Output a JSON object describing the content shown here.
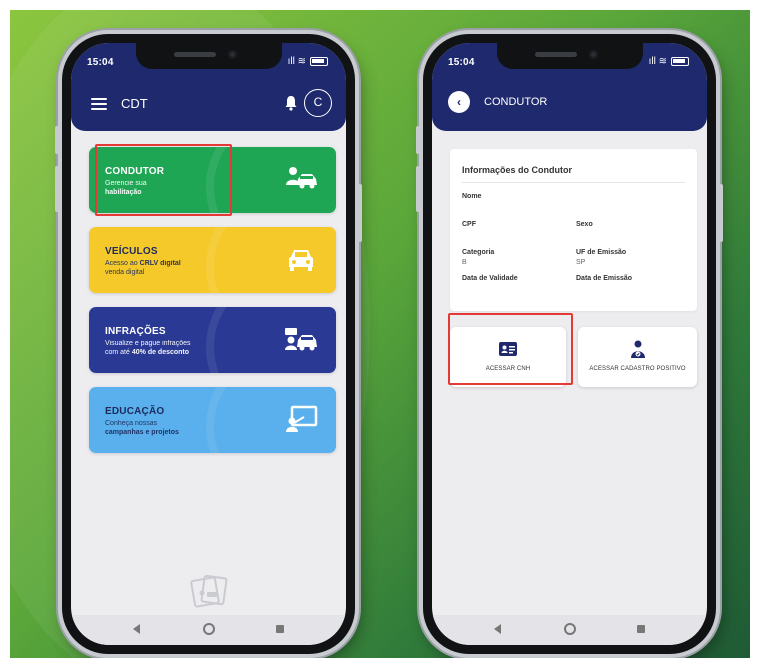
{
  "colors": {
    "appbar": "#1f2a6e",
    "condutor": "#1fa655",
    "veiculos": "#f6c92a",
    "infracoes": "#2a3a94",
    "educacao": "#5ab0ec",
    "highlight": "#e53935"
  },
  "home": {
    "status": {
      "time": "15:04",
      "icons": "ıll ≋"
    },
    "appbar": {
      "menu_icon": "hamburger-menu-icon",
      "title": "CDT",
      "bell_icon": "bell-icon",
      "avatar_letter": "C"
    },
    "cards": [
      {
        "title": "CONDUTOR",
        "desc_1": "Gerencie sua",
        "desc_2": "habilitação",
        "icon": "driver-car-icon"
      },
      {
        "title": "VEÍCULOS",
        "desc_1a": "Acesso ao ",
        "desc_1b": "CRLV digital",
        "desc_2": "venda digital",
        "icon": "car-front-icon"
      },
      {
        "title": "INFRAÇÕES",
        "desc_1": "Visualize e pague infrações",
        "desc_2a": "com até ",
        "desc_2b": "40% de desconto",
        "icon": "traffic-fine-icon"
      },
      {
        "title": "EDUCAÇÃO",
        "desc_1": "Conheça nossas",
        "desc_2": "campanhas e projetos",
        "icon": "presentation-icon"
      }
    ]
  },
  "condutor": {
    "status": {
      "time": "15:04",
      "icons": "ıll ≋"
    },
    "appbar": {
      "back_icon": "back-arrow-icon",
      "title": "CONDUTOR"
    },
    "info": {
      "title": "Informações do Condutor",
      "fields": [
        {
          "label": "Nome",
          "value": ""
        },
        {
          "label": "CPF",
          "value": ""
        },
        {
          "label": "Sexo",
          "value": ""
        },
        {
          "label": "Categoria",
          "value": "B"
        },
        {
          "label": "UF de Emissão",
          "value": "SP"
        },
        {
          "label": "Data de Validade",
          "value": ""
        },
        {
          "label": "Data de Emissão",
          "value": ""
        }
      ]
    },
    "actions": [
      {
        "label": "ACESSAR CNH",
        "icon": "id-card-icon"
      },
      {
        "label": "ACESSAR CADASTRO POSITIVO",
        "icon": "person-registry-icon"
      }
    ]
  }
}
